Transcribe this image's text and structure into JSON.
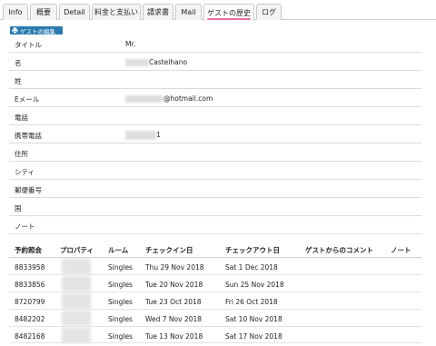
{
  "tabs": [
    {
      "label": "Info",
      "active": false
    },
    {
      "label": "概要",
      "active": false
    },
    {
      "label": "Detail",
      "active": false
    },
    {
      "label": "料金と支払い",
      "active": false
    },
    {
      "label": "請求書",
      "active": false
    },
    {
      "label": "Mail",
      "active": false
    },
    {
      "label": "ゲストの歴史",
      "active": true
    },
    {
      "label": "ログ",
      "active": false
    }
  ],
  "edit_button_label": "ゲストの編集",
  "guest_fields": [
    {
      "label": "タイトル",
      "value": "Mr."
    },
    {
      "label": "名",
      "value": "Castelhano"
    },
    {
      "label": "姓",
      "value": ""
    },
    {
      "label": "Eメール",
      "value": "@hotmail.com"
    },
    {
      "label": "電話",
      "value": ""
    },
    {
      "label": "携帯電話",
      "value": "1"
    },
    {
      "label": "住所",
      "value": ""
    },
    {
      "label": "シティ",
      "value": ""
    },
    {
      "label": "郵便番号",
      "value": ""
    },
    {
      "label": "国",
      "value": ""
    },
    {
      "label": "ノート",
      "value": ""
    }
  ],
  "history": {
    "columns": [
      "予約照会",
      "プロパティ",
      "ルーム",
      "チェックイン日",
      "チェックアウト日",
      "ゲストからのコメント",
      "ノート"
    ],
    "rows": [
      {
        "booking": "8833958",
        "property": "",
        "room": "Singles",
        "checkin": "Thu 29 Nov 2018",
        "checkout": "Sat 1 Dec 2018",
        "comment": "",
        "note": ""
      },
      {
        "booking": "8833856",
        "property": "",
        "room": "Singles",
        "checkin": "Tue 20 Nov 2018",
        "checkout": "Sun 25 Nov 2018",
        "comment": "",
        "note": ""
      },
      {
        "booking": "8720799",
        "property": "",
        "room": "Singles",
        "checkin": "Tue 23 Oct 2018",
        "checkout": "Fri 26 Oct 2018",
        "comment": "",
        "note": ""
      },
      {
        "booking": "8482202",
        "property": "",
        "room": "Singles",
        "checkin": "Wed 7 Nov 2018",
        "checkout": "Sat 10 Nov 2018",
        "comment": "",
        "note": ""
      },
      {
        "booking": "8482168",
        "property": "",
        "room": "Singles",
        "checkin": "Tue 13 Nov 2018",
        "checkout": "Sat 17 Nov 2018",
        "comment": "",
        "note": ""
      }
    ]
  },
  "colors": {
    "accent_underline": "#e36fa4",
    "edit_button": "#2a7ab0"
  },
  "icons": {
    "edit_button": "printer-icon"
  }
}
